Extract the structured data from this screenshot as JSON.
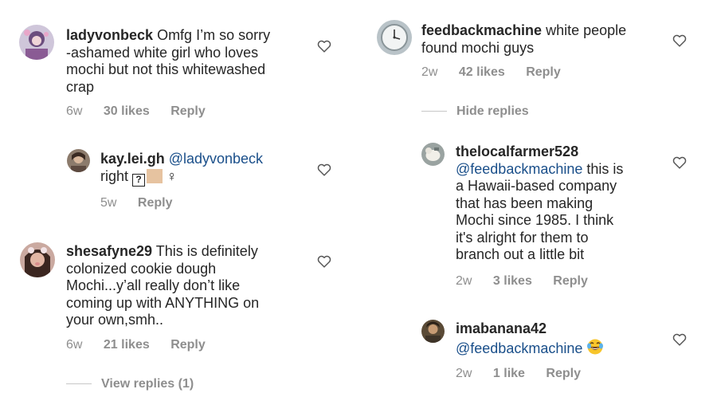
{
  "comments": [
    {
      "username": "ladyvonbeck",
      "text": "Omfg I’m so sorry -ashamed white girl who loves mochi but not this whitewashed crap",
      "lines": [
        "Omfg I’m so sorry",
        "-ashamed white girl who loves",
        "mochi but not this whitewashed",
        "crap"
      ],
      "time": "6w",
      "likes": "30 likes",
      "reply": "Reply"
    },
    {
      "username": "kay.lei.gh",
      "mention": "@ladyvonbeck",
      "text": "right",
      "boxed_glyph": "?",
      "extra_glyph": "♀",
      "time": "5w",
      "reply": "Reply"
    },
    {
      "username": "shesafyne29",
      "text": "This is definitely colonized cookie dough Mochi...y’all really don’t like coming up with ANYTHING on your own,smh..",
      "lines": [
        "This is definitely",
        "colonized cookie dough",
        "Mochi...y’all really don’t like",
        "coming up with ANYTHING on",
        "your own,smh.."
      ],
      "time": "6w",
      "likes": "21 likes",
      "reply": "Reply",
      "view_replies": "View replies (1)"
    },
    {
      "username": "feedbackmachine",
      "text": "white people found mochi guys",
      "lines": [
        "white people",
        "found mochi guys"
      ],
      "time": "2w",
      "likes": "42 likes",
      "reply": "Reply",
      "hide_replies": "Hide replies"
    },
    {
      "username": "thelocalfarmer528",
      "mention": "@feedbackmachine",
      "text": "this is a Hawaii-based company that has been making Mochi since 1985. I think it's alright for them to branch out a little bit",
      "lines": [
        "this is",
        "a Hawaii-based company",
        "that has been making",
        "Mochi since 1985. I think",
        "it's alright for them to",
        "branch out a little bit"
      ],
      "time": "2w",
      "likes": "3 likes",
      "reply": "Reply"
    },
    {
      "username": "imabanana42",
      "mention": "@feedbackmachine",
      "emoji": "face-with-tears-of-joy",
      "time": "2w",
      "likes": "1 like",
      "reply": "Reply"
    }
  ],
  "colors": {
    "mention": "#1a4f8a",
    "meta": "#8e8e8e",
    "text": "#262626"
  }
}
